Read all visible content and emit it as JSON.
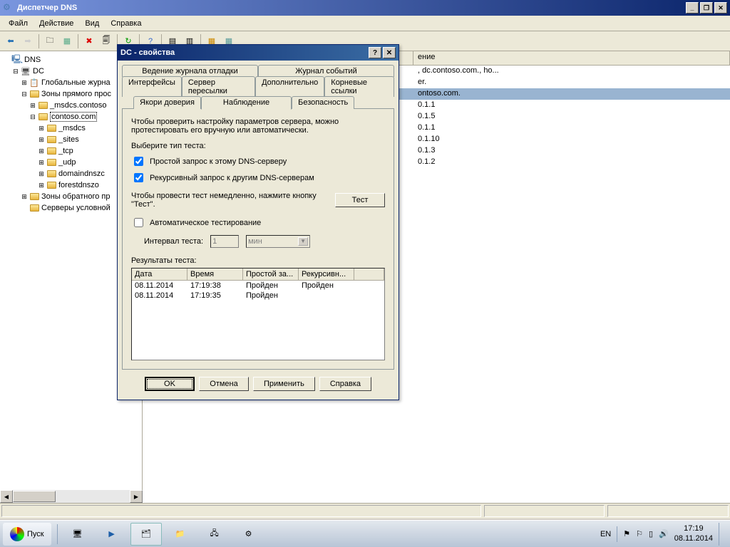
{
  "window": {
    "title": "Диспетчер DNS"
  },
  "menu": {
    "file": "Файл",
    "action": "Действие",
    "view": "Вид",
    "help": "Справка"
  },
  "tree": {
    "root": "DNS",
    "server": "DC",
    "globalLogs": "Глобальные журна",
    "fwdZones": "Зоны прямого прос",
    "msdcs_contoso": "_msdcs.contoso",
    "contoso": "contoso.com",
    "msdcs": "_msdcs",
    "sites": "_sites",
    "tcp": "_tcp",
    "udp": "_udp",
    "domaindns": "domaindnszc",
    "forestdns": "forestdnszo",
    "revZones": "Зоны обратного пр",
    "condFwd": "Серверы условной"
  },
  "listHeader": {
    "col3": "ение"
  },
  "listRows": {
    "r1c3": ", dc.contoso.com., ho...",
    "r2c3": "er.",
    "r3c3": "ontoso.com.",
    "r4c3": "0.1.1",
    "r5c3": "0.1.5",
    "r6c3": "0.1.1",
    "r7c3": "0.1.10",
    "r8c3": "0.1.3",
    "r9c3": "0.1.2"
  },
  "dialog": {
    "title": "DC - свойства",
    "tabs": {
      "debugLog": "Ведение журнала отладки",
      "eventLog": "Журнал событий",
      "interfaces": "Интерфейсы",
      "forwarders": "Сервер пересылки",
      "advanced": "Дополнительно",
      "rootHints": "Корневые ссылки",
      "trustAnchors": "Якори доверия",
      "monitoring": "Наблюдение",
      "security": "Безопасность"
    },
    "desc": "Чтобы проверить настройку параметров сервера, можно протестировать его вручную или автоматически.",
    "selectTest": "Выберите тип теста:",
    "chkSimple": "Простой запрос к этому DNS-серверу",
    "chkRecursive": "Рекурсивный запрос к другим DNS-серверам",
    "immediateTest": "Чтобы провести тест немедленно, нажмите кнопку \"Тест\".",
    "testBtn": "Тест",
    "chkAuto": "Автоматическое тестирование",
    "intervalLabel": "Интервал теста:",
    "intervalVal": "1",
    "intervalUnit": "мин",
    "resultsLabel": "Результаты теста:",
    "resHead": {
      "date": "Дата",
      "time": "Время",
      "simple": "Простой за...",
      "recursive": "Рекурсивн..."
    },
    "resRows": [
      {
        "date": "08.11.2014",
        "time": "17:19:38",
        "simple": "Пройден",
        "recursive": "Пройден"
      },
      {
        "date": "08.11.2014",
        "time": "17:19:35",
        "simple": "Пройден",
        "recursive": ""
      }
    ],
    "buttons": {
      "ok": "OK",
      "cancel": "Отмена",
      "apply": "Применить",
      "help": "Справка"
    }
  },
  "taskbar": {
    "start": "Пуск",
    "lang": "EN",
    "time": "17:19",
    "date": "08.11.2014"
  }
}
